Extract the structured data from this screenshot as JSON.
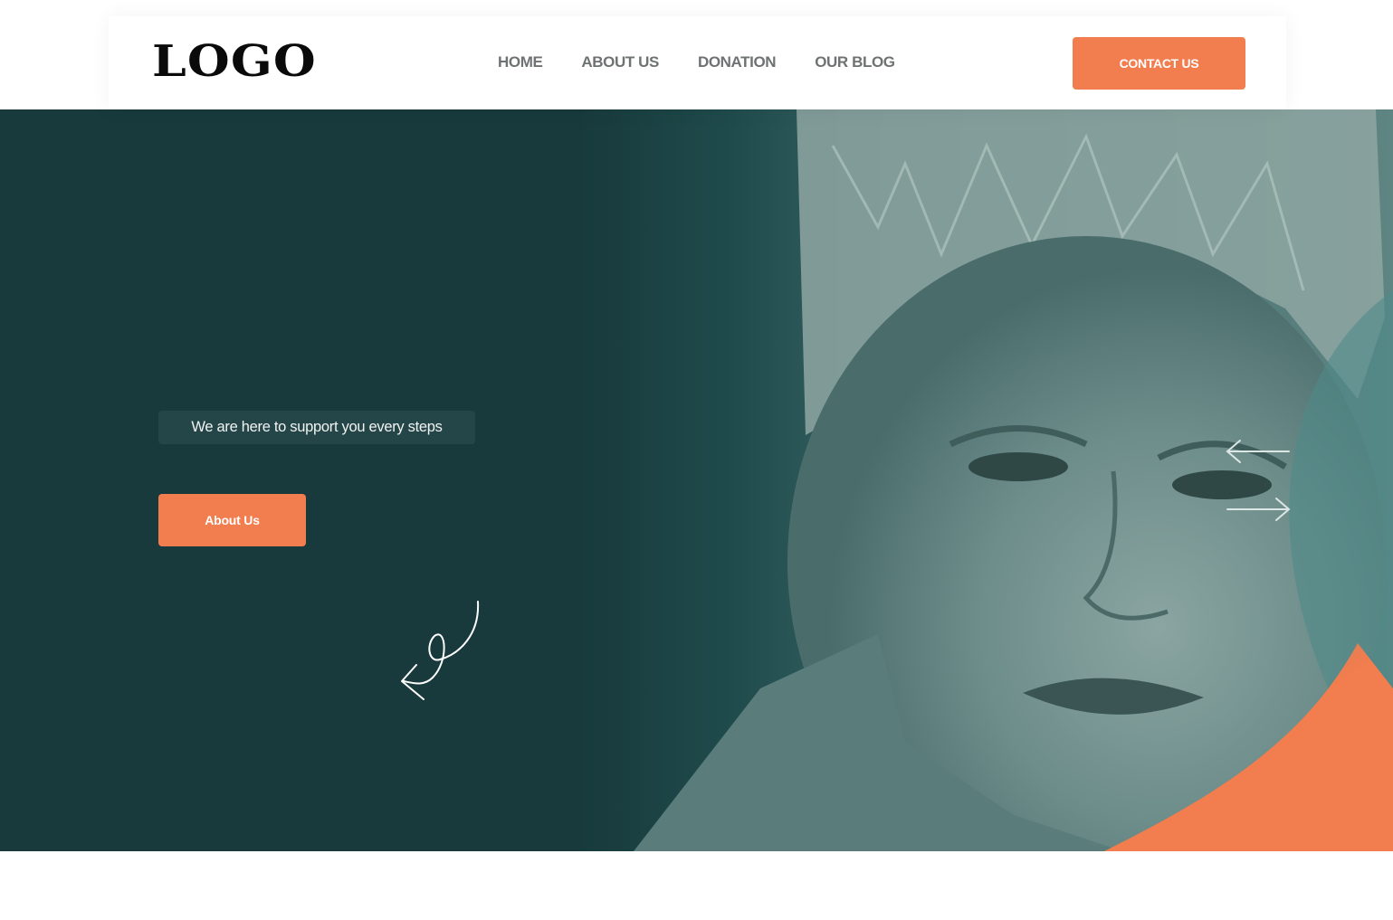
{
  "header": {
    "logo_text": "LOGO",
    "nav": [
      "HOME",
      "ABOUT US",
      "DONATION",
      "OUR BLOG"
    ],
    "contact_label": "CONTACT US"
  },
  "hero": {
    "tagline": "We are here to support you every steps",
    "about_label": "About Us",
    "image_icon": "boy-portrait-photo",
    "prev_icon": "arrow-left-icon",
    "next_icon": "arrow-right-icon",
    "decor_icon": "curly-arrow-icon"
  },
  "colors": {
    "accent": "#f27d4e",
    "hero_bg": "#183a3c",
    "teal_curve": "#4e8a88",
    "nav_text": "#6e7272"
  }
}
